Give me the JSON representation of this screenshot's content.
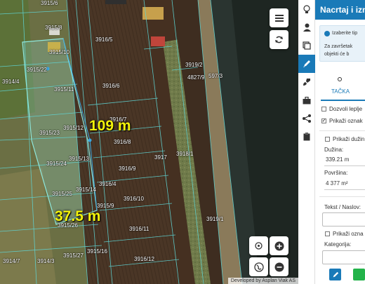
{
  "map": {
    "parcels": [
      {
        "id": "3915/6"
      },
      {
        "id": "3915/8"
      },
      {
        "id": "3915/10"
      },
      {
        "id": "3915/22"
      },
      {
        "id": "3915/11"
      },
      {
        "id": "3915/23"
      },
      {
        "id": "3915/12"
      },
      {
        "id": "3915/13"
      },
      {
        "id": "3915/24"
      },
      {
        "id": "3915/14"
      },
      {
        "id": "3915/25"
      },
      {
        "id": "3915/26"
      },
      {
        "id": "3915/27"
      },
      {
        "id": "3914/4"
      },
      {
        "id": "3914/3"
      },
      {
        "id": "3914/7"
      },
      {
        "id": "3916/5"
      },
      {
        "id": "3916/6"
      },
      {
        "id": "3916/7"
      },
      {
        "id": "3916/8"
      },
      {
        "id": "3916/9"
      },
      {
        "id": "3916/4"
      },
      {
        "id": "3916/10"
      },
      {
        "id": "3915/9"
      },
      {
        "id": "3916/11"
      },
      {
        "id": "3915/16"
      },
      {
        "id": "3916/12"
      },
      {
        "id": "3917"
      },
      {
        "id": "3918/1"
      },
      {
        "id": "3919/2"
      },
      {
        "id": "4827/9"
      },
      {
        "id": "597/3"
      },
      {
        "id": "3919/1"
      }
    ],
    "measurements": {
      "length": "109 m",
      "width": "37.5 m"
    },
    "attribution": "Developed by Asplan Viak AS",
    "colors": {
      "parcel_line": "#5fd6d6",
      "measure_text": "#f3f20a",
      "selected_fill": "#8fd3c8"
    },
    "controls": {
      "menu_icon": "hamburger-icon",
      "refresh_icon": "refresh-icon",
      "locate_icon": "crosshair-icon",
      "zoom_in_icon": "plus-icon",
      "layers_icon": "globe-icon",
      "zoom_out_icon": "minus-icon"
    }
  },
  "rail": {
    "items": [
      {
        "name": "lightbulb-icon",
        "active": false
      },
      {
        "name": "person-icon",
        "active": false
      },
      {
        "name": "layers-icon",
        "active": false
      },
      {
        "name": "pencil-icon",
        "active": true
      },
      {
        "name": "brush-icon",
        "active": false
      },
      {
        "name": "briefcase-icon",
        "active": false
      },
      {
        "name": "share-icon",
        "active": false
      },
      {
        "name": "clipboard-icon",
        "active": false
      }
    ]
  },
  "panel": {
    "title": "Nacrtaj i izme",
    "info": {
      "line1": "Izaberite tip",
      "line2": "Za završetak",
      "line3": "objekti će b"
    },
    "tab_point": "TAČKA",
    "options": {
      "snap": {
        "label": "Dozvoli leplje",
        "checked": false
      },
      "show_labels": {
        "label": "Prikaži oznak",
        "checked": true
      },
      "show_lengths": {
        "label": "Prikaži dužin",
        "checked": false
      }
    },
    "length": {
      "label": "Dužina:",
      "value": "339.21 m"
    },
    "area": {
      "label": "Površina:",
      "value": "4 377 m²"
    },
    "text_label": "Tekst / Naslov:",
    "show_marks": {
      "label": "Prikaži ozna",
      "checked": false
    },
    "category_label": "Kategorija:"
  }
}
